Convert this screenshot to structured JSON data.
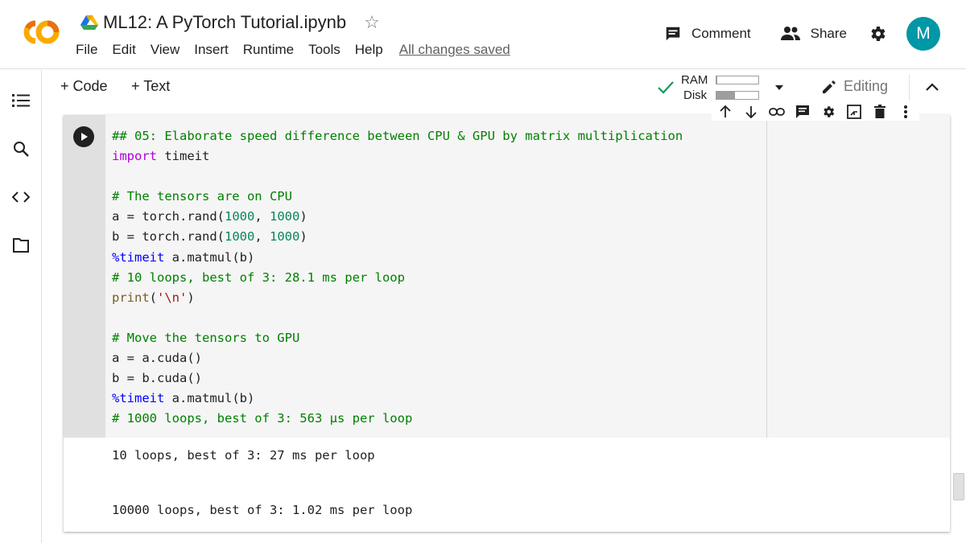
{
  "header": {
    "title": "ML12: A PyTorch Tutorial.ipynb",
    "star_icon": "star-outline-icon",
    "menu": [
      "File",
      "Edit",
      "View",
      "Insert",
      "Runtime",
      "Tools",
      "Help"
    ],
    "save_status": "All changes saved",
    "comment_label": "Comment",
    "share_label": "Share",
    "avatar_letter": "M",
    "avatar_color": "#0097a7"
  },
  "toolbar": {
    "add_code": "+ Code",
    "add_text": "+ Text",
    "ram_label": "RAM",
    "disk_label": "Disk",
    "ram_usage": 0.02,
    "disk_usage": 0.45,
    "editing_label": "Editing"
  },
  "cell": {
    "code_lines": [
      [
        {
          "t": "## 05: Elaborate speed difference between CPU & GPU by matrix multiplication",
          "c": "com"
        }
      ],
      [
        {
          "t": "import",
          "c": "kw"
        },
        {
          "t": " timeit",
          "c": ""
        }
      ],
      [
        {
          "t": "",
          "c": ""
        }
      ],
      [
        {
          "t": "# The tensors are on CPU",
          "c": "com"
        }
      ],
      [
        {
          "t": "a = torch.rand(",
          "c": ""
        },
        {
          "t": "1000",
          "c": "num"
        },
        {
          "t": ", ",
          "c": ""
        },
        {
          "t": "1000",
          "c": "num"
        },
        {
          "t": ")",
          "c": ""
        }
      ],
      [
        {
          "t": "b = torch.rand(",
          "c": ""
        },
        {
          "t": "1000",
          "c": "num"
        },
        {
          "t": ", ",
          "c": ""
        },
        {
          "t": "1000",
          "c": "num"
        },
        {
          "t": ")",
          "c": ""
        }
      ],
      [
        {
          "t": "%timeit",
          "c": "magic"
        },
        {
          "t": " a.matmul(b)",
          "c": ""
        }
      ],
      [
        {
          "t": "# 10 loops, best of 3: 28.1 ms per loop",
          "c": "com"
        }
      ],
      [
        {
          "t": "print",
          "c": "fn"
        },
        {
          "t": "(",
          "c": ""
        },
        {
          "t": "'\\n'",
          "c": "str"
        },
        {
          "t": ")",
          "c": ""
        }
      ],
      [
        {
          "t": "",
          "c": ""
        }
      ],
      [
        {
          "t": "# Move the tensors to GPU",
          "c": "com"
        }
      ],
      [
        {
          "t": "a = a.cuda()",
          "c": ""
        }
      ],
      [
        {
          "t": "b = b.cuda()",
          "c": ""
        }
      ],
      [
        {
          "t": "%timeit",
          "c": "magic"
        },
        {
          "t": " a.matmul(b)",
          "c": ""
        }
      ],
      [
        {
          "t": "# 1000 loops, best of 3: 563 µs per loop",
          "c": "com"
        }
      ]
    ],
    "output_lines": [
      "10 loops, best of 3: 27 ms per loop",
      "10000 loops, best of 3: 1.02 ms per loop"
    ]
  }
}
